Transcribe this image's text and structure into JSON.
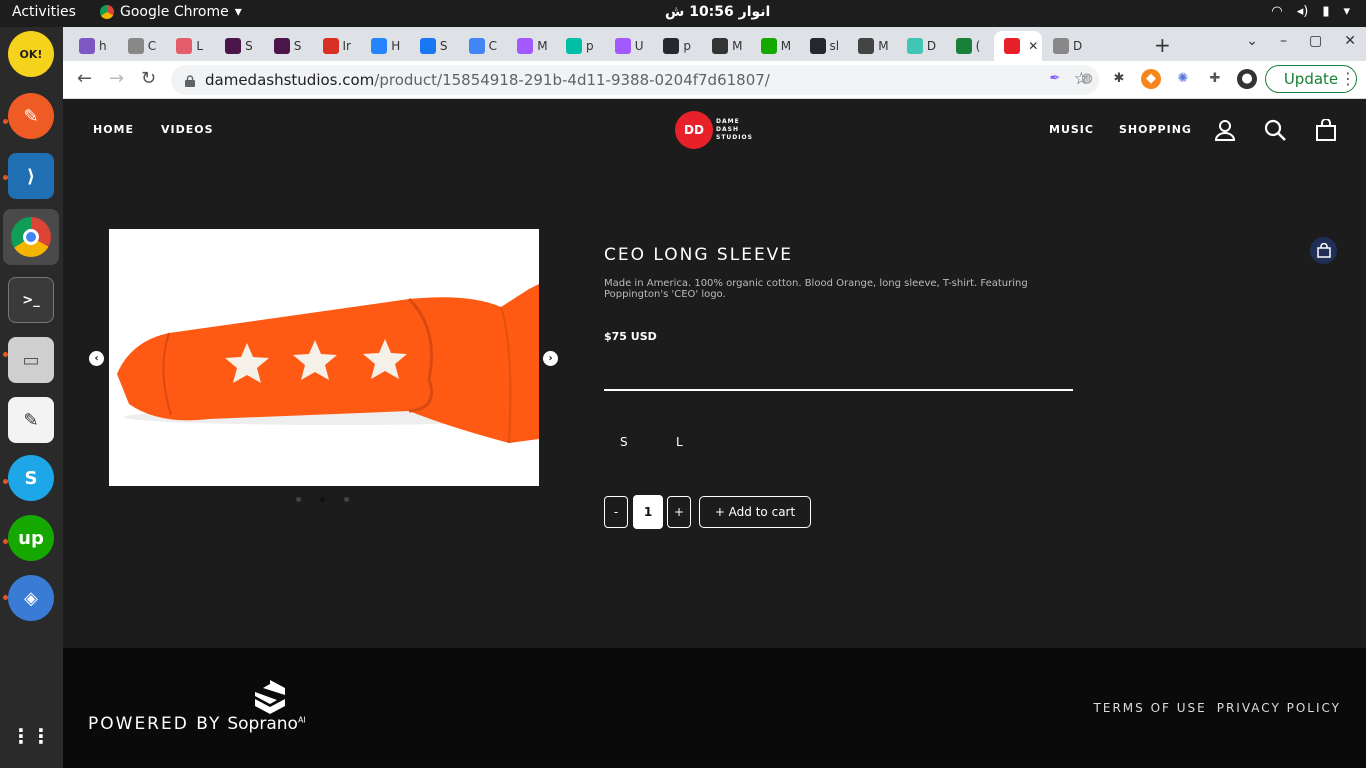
{
  "desktop": {
    "activities": "Activities",
    "app_name": "Google Chrome",
    "clock": "انوار 10:56 ش"
  },
  "browser": {
    "tabs": [
      "h",
      "C",
      "L",
      "S",
      "S",
      "Ir",
      "H",
      "S",
      "C",
      "M",
      "p",
      "U",
      "p",
      "M",
      "M",
      "sl",
      "M",
      "D",
      "(",
      "",
      "D"
    ],
    "url_domain": "damedashstudios.com",
    "url_path": "/product/15854918-291b-4d11-9388-0204f7d61807/",
    "update_label": "Update"
  },
  "site": {
    "nav_left": [
      "HOME",
      "VIDEOS"
    ],
    "nav_right": [
      "MUSIC",
      "SHOPPING"
    ],
    "logo_lines": [
      "DAME",
      "DASH",
      "STUDIOS"
    ]
  },
  "product": {
    "title": "CEO LONG SLEEVE",
    "description": "Made in America. 100% organic cotton. Blood Orange, long sleeve, T-shirt. Featuring Poppington's 'CEO' logo.",
    "price": "$75 USD",
    "sizes": [
      "S",
      "L"
    ],
    "qty_minus": "-",
    "qty_value": "1",
    "qty_plus": "+",
    "add_to_cart": "+ Add to cart",
    "color": "#ff5a14"
  },
  "footer": {
    "powered_by": "POWERED BY",
    "brand": "Soprano",
    "brand_sup": "AI",
    "links": [
      "TERMS OF USE",
      "PRIVACY POLICY"
    ]
  }
}
